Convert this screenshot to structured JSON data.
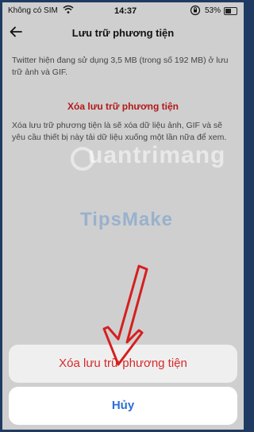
{
  "status_bar": {
    "carrier": "Không có SIM",
    "time": "14:37",
    "battery": "53%"
  },
  "nav": {
    "back_icon": "arrow-left",
    "title": "Lưu trữ phương tiện"
  },
  "content": {
    "usage_text": "Twitter hiện đang sử dụng 3,5 MB (trong số 192 MB) ở lưu trữ ảnh và GIF.",
    "clear_title": "Xóa lưu trữ phương tiện",
    "clear_description": "Xóa lưu trữ phương tiện là sẽ xóa dữ liệu ảnh, GIF và sẽ yêu cầu thiết bị này tải dữ liệu xuống một lần nữa để xem."
  },
  "watermarks": {
    "primary": "uantrimang",
    "secondary": "TipsMake"
  },
  "action_sheet": {
    "confirm_label": "Xóa lưu trữ phương tiện",
    "cancel_label": "Hủy"
  },
  "colors": {
    "accent_red": "#d42a2a",
    "cancel_blue": "#2b6fd6",
    "frame": "#1f3b63"
  }
}
